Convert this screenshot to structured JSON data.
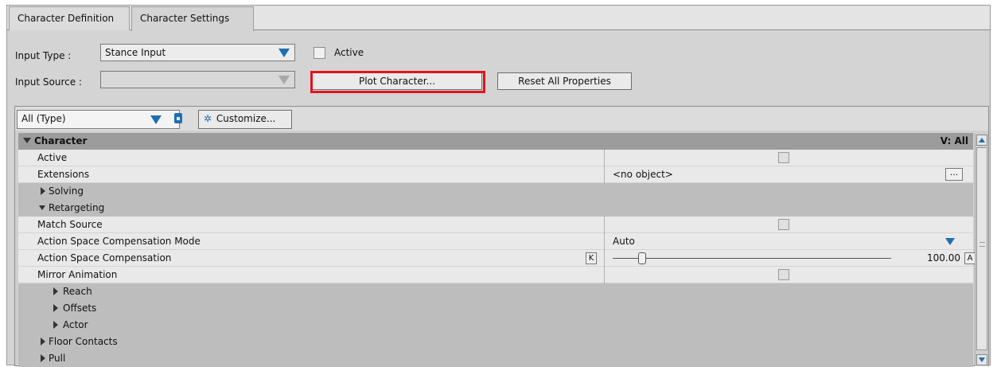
{
  "tabs": [
    {
      "label": "Character Definition",
      "active": false
    },
    {
      "label": "Character Settings",
      "active": true
    }
  ],
  "input_type": {
    "label": "Input Type :",
    "value": "Stance Input",
    "active_label": "Active",
    "active_checked": false
  },
  "input_source": {
    "label": "Input Source :",
    "value": ""
  },
  "buttons": {
    "plot": "Plot Character...",
    "reset": "Reset All Properties"
  },
  "highlight_color": "#e1141c",
  "filter": {
    "value": "All (Type)",
    "customize": "Customize..."
  },
  "properties": {
    "section": "Character",
    "section_value": "V: All",
    "active": "Active",
    "extensions": "Extensions",
    "extensions_value": "<no object>",
    "extensions_button": "...",
    "solving": "Solving",
    "retargeting": "Retargeting",
    "match_source": "Match Source",
    "asc_mode": "Action Space Compensation Mode",
    "asc_mode_value": "Auto",
    "asc": "Action Space Compensation",
    "asc_key": "K",
    "asc_value": "100.00",
    "asc_anim": "A",
    "mirror": "Mirror Animation",
    "reach": "Reach",
    "offsets": "Offsets",
    "actor": "Actor",
    "floor": "Floor Contacts",
    "pull": "Pull"
  },
  "accent_color": "#1f6fb0"
}
